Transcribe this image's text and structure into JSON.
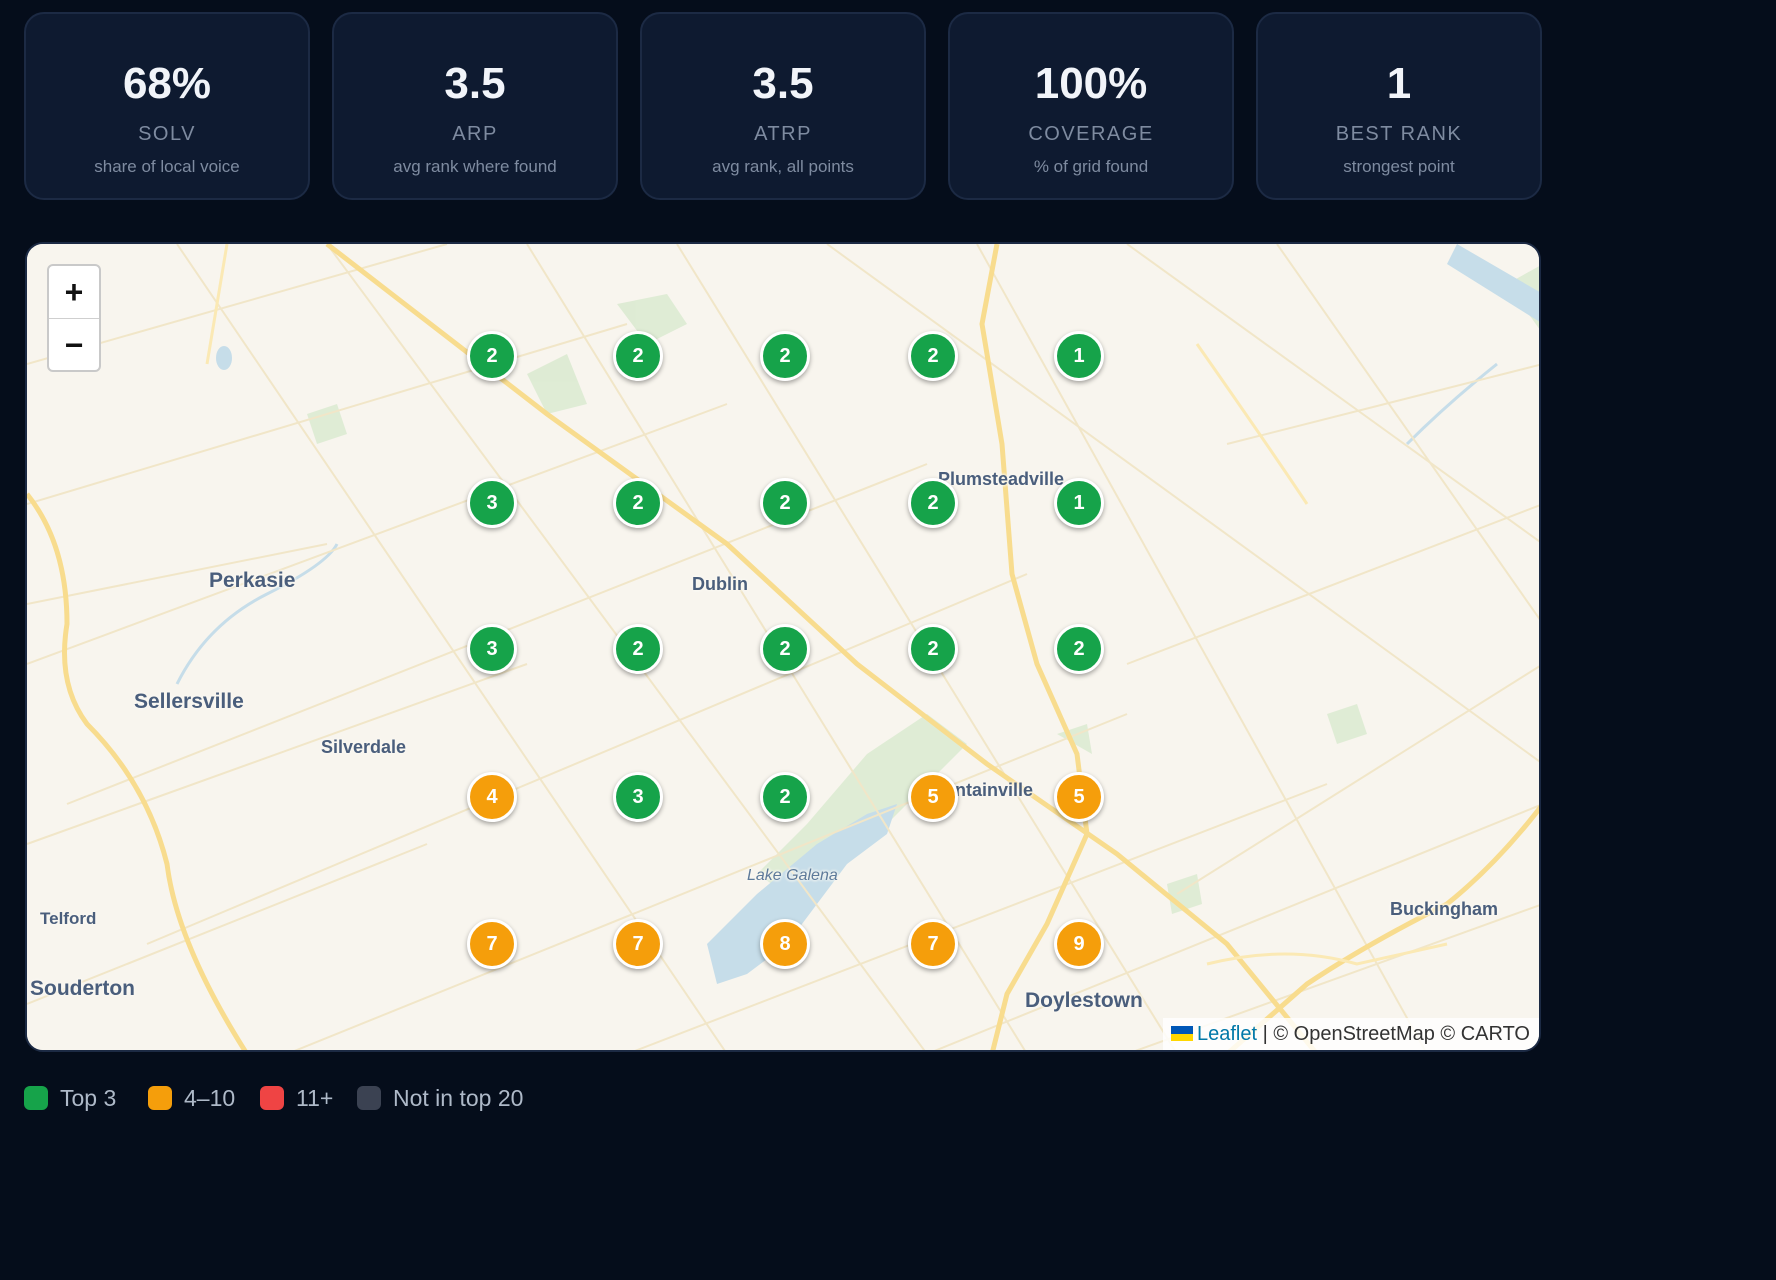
{
  "stats": [
    {
      "value": "68%",
      "label": "SOLV",
      "sub": "share of local voice"
    },
    {
      "value": "3.5",
      "label": "ARP",
      "sub": "avg rank where found"
    },
    {
      "value": "3.5",
      "label": "ATRP",
      "sub": "avg rank, all points"
    },
    {
      "value": "100%",
      "label": "COVERAGE",
      "sub": "% of grid found"
    },
    {
      "value": "1",
      "label": "BEST RANK",
      "sub": "strongest point"
    }
  ],
  "map": {
    "zoom_in_label": "+",
    "zoom_out_label": "−",
    "places": [
      {
        "name": "Perkasie"
      },
      {
        "name": "Sellersville"
      },
      {
        "name": "Silverdale"
      },
      {
        "name": "Dublin"
      },
      {
        "name": "Plumsteadville"
      },
      {
        "name": "ntainville"
      },
      {
        "name": "Lake Galena"
      },
      {
        "name": "Telford"
      },
      {
        "name": "Souderton"
      },
      {
        "name": "Doylestown"
      },
      {
        "name": "Buckingham"
      }
    ],
    "grid_ranks": [
      [
        2,
        2,
        2,
        2,
        1
      ],
      [
        3,
        2,
        2,
        2,
        1
      ],
      [
        3,
        2,
        2,
        2,
        2
      ],
      [
        4,
        3,
        2,
        5,
        5
      ],
      [
        7,
        7,
        8,
        7,
        9
      ]
    ],
    "attribution": {
      "leaflet": "Leaflet",
      "rest": "| © OpenStreetMap © CARTO"
    }
  },
  "colors": {
    "top3": "#16a34a",
    "mid": "#f59e0b",
    "low": "#ef4444",
    "none": "#3b4252"
  },
  "legend": [
    {
      "label": "Top 3",
      "color": "#16a34a"
    },
    {
      "label": "4–10",
      "color": "#f59e0b"
    },
    {
      "label": "11+",
      "color": "#ef4444"
    },
    {
      "label": "Not in top 20",
      "color": "#3b4252"
    }
  ]
}
